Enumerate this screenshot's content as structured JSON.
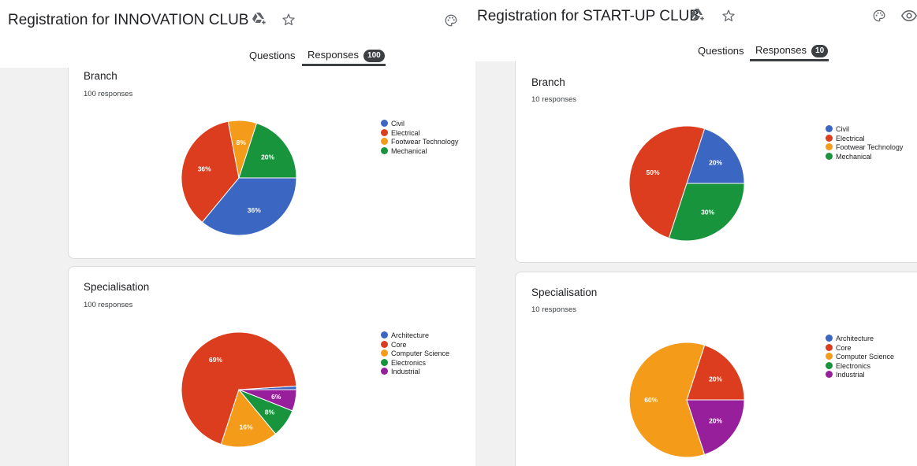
{
  "colors": {
    "Civil": "#3b66c2",
    "Electrical": "#dc3d1f",
    "Footwear Technology": "#f59b1a",
    "Mechanical": "#18943d",
    "Architecture": "#3b66c2",
    "Core": "#dc3d1f",
    "Computer Science": "#f59b1a",
    "Electronics": "#18943d",
    "Industrial": "#971f9c"
  },
  "left": {
    "form_title": "Registration for INNOVATION CLUB",
    "tabs": {
      "questions": "Questions",
      "responses": "Responses",
      "responses_count": "100"
    },
    "branch": {
      "title": "Branch",
      "count_text": "100 responses"
    },
    "specialisation": {
      "title": "Specialisation",
      "count_text": "100 responses"
    }
  },
  "right": {
    "form_title": "Registration for START-UP CLUB",
    "tabs": {
      "questions": "Questions",
      "responses": "Responses",
      "responses_count": "10"
    },
    "branch": {
      "title": "Branch",
      "count_text": "10 responses"
    },
    "specialisation": {
      "title": "Specialisation",
      "count_text": "10 responses"
    }
  },
  "chart_data": [
    {
      "type": "pie",
      "title": "Branch",
      "categories": [
        "Civil",
        "Electrical",
        "Footwear Technology",
        "Mechanical"
      ],
      "values": [
        36,
        36,
        8,
        20
      ],
      "labels": [
        "36%",
        "36%",
        "8%",
        "20%"
      ]
    },
    {
      "type": "pie",
      "title": "Specialisation",
      "categories": [
        "Architecture",
        "Core",
        "Computer Science",
        "Electronics",
        "Industrial"
      ],
      "values": [
        1,
        69,
        16,
        8,
        6
      ],
      "labels": [
        "",
        "69%",
        "16%",
        "8%",
        "6%"
      ]
    },
    {
      "type": "pie",
      "title": "Branch",
      "categories": [
        "Civil",
        "Electrical",
        "Footwear Technology",
        "Mechanical"
      ],
      "values": [
        20,
        50,
        0,
        30
      ],
      "labels": [
        "20%",
        "50%",
        "",
        "30%"
      ]
    },
    {
      "type": "pie",
      "title": "Specialisation",
      "categories": [
        "Architecture",
        "Core",
        "Computer Science",
        "Electronics",
        "Industrial"
      ],
      "values": [
        0,
        20,
        60,
        0,
        20
      ],
      "labels": [
        "",
        "20%",
        "60%",
        "",
        "20%"
      ]
    }
  ]
}
